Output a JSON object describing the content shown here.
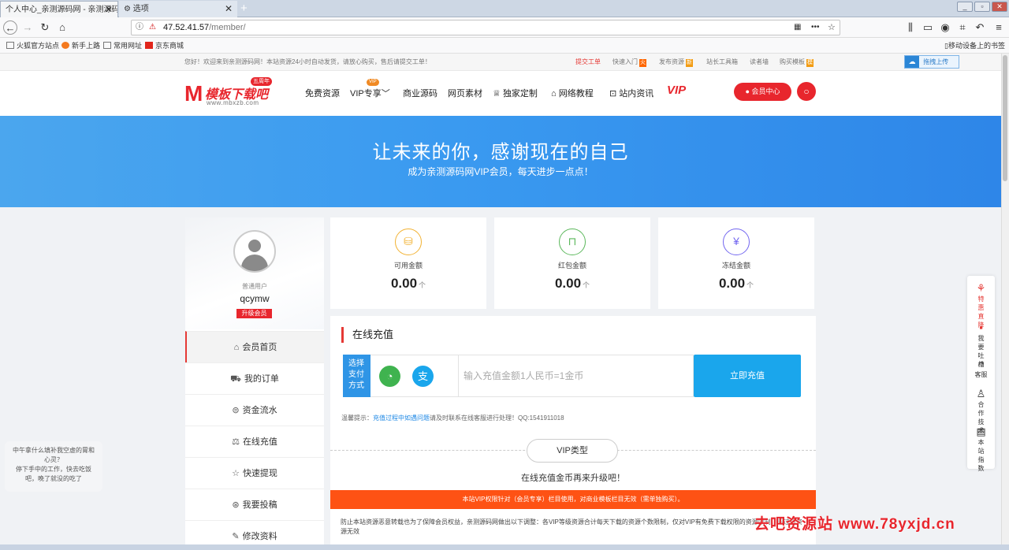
{
  "browser": {
    "tabs": [
      {
        "title": "个人中心_亲测源码网 - 亲测源码网"
      },
      {
        "title": "选项"
      }
    ],
    "new_tab": "+",
    "url": "47.52.41.57/member/",
    "url_host": "47.52.41.57",
    "url_path": "/member/",
    "bookmarks": [
      "火狐官方站点",
      "新手上路",
      "常用网址",
      "京东商城"
    ],
    "mobile_bookmarks": "移动设备上的书签"
  },
  "notice": {
    "text": "您好！欢迎来到亲测源码网！本站资源24小时自动发货，请放心购买，售后请提交工单！",
    "links": [
      "提交工单",
      "快速入门",
      "发布资源",
      "站长工具箱",
      "读者墙",
      "购买模板"
    ],
    "upload": "拖拽上传"
  },
  "header": {
    "logo_text": "模板下载吧",
    "logo_domain": "www.mbxzb.com",
    "logo_badge": "五周年",
    "menu": [
      "免费资源",
      "VIP专享",
      "商业源码",
      "网页素材",
      "独家定制",
      "网络教程",
      "站内资讯"
    ],
    "vip_badge": "VIP",
    "vip_logo": "VIP",
    "member_btn": "会员中心"
  },
  "banner": {
    "title": "让未来的你，感谢现在的自己",
    "subtitle": "成为亲测源码网VIP会员，每天进步一点点！"
  },
  "profile": {
    "role": "普通用户",
    "username": "qcymw",
    "upgrade": "升级会员"
  },
  "sidebar": {
    "items": [
      {
        "label": "会员首页",
        "icon": "home-icon"
      },
      {
        "label": "我的订单",
        "icon": "cart-icon"
      },
      {
        "label": "资金流水",
        "icon": "money-icon"
      },
      {
        "label": "在线充值",
        "icon": "recharge-icon"
      },
      {
        "label": "快速提现",
        "icon": "star-icon"
      },
      {
        "label": "我要投稿",
        "icon": "submit-icon"
      },
      {
        "label": "修改资料",
        "icon": "edit-icon"
      }
    ]
  },
  "stats": [
    {
      "label": "可用金额",
      "value": "0.00",
      "unit": "个",
      "color": "#f2b233"
    },
    {
      "label": "红包金额",
      "value": "0.00",
      "unit": "个",
      "color": "#5cb85c"
    },
    {
      "label": "冻结金额",
      "value": "0.00",
      "unit": "个",
      "color": "#7367f0"
    }
  ],
  "recharge": {
    "title": "在线充值",
    "pay_label": "选择支付方式",
    "amount_placeholder": "输入充值金额1人民币=1金币",
    "button": "立即充值",
    "tip_prefix": "温馨提示：",
    "tip_link": "充值过程中如遇问题",
    "tip_suffix": "请及时联系在线客服进行处理！QQ:1541911018",
    "vip_type": "VIP类型",
    "vip_sub": "在线充值金币再来升级吧！",
    "orange_note": "本站VIP权限针对（会员专享）栏目使用，对商业模板栏目无效（需单独购买）。",
    "terms": "防止本站资源恶意转载也为了保障会员权益，亲测源码网做出以下调整：各VIP等级资源合计每天下载的资源个数限制，仅对VIP有免费下载权限的资源限制，超过的资源无效"
  },
  "float_bar": [
    {
      "label": "特惠直降",
      "icon": "gift-icon",
      "color": "#e53935"
    },
    {
      "label": "我要吐槽",
      "icon": "comment-icon",
      "color": "#333"
    },
    {
      "label": "客服",
      "icon": "headset-icon",
      "color": "#333"
    },
    {
      "label": "合作技术",
      "icon": "user-icon",
      "color": "#333"
    },
    {
      "label": "本站指数",
      "icon": "clipboard-icon",
      "color": "#333"
    }
  ],
  "chat": {
    "line1": "中午拿什么填补我空虚的胃和心灵？",
    "line2": "停下手中的工作，快去吃饭吧，晚了就没的吃了"
  },
  "watermark": "去吧资源站 www.78yxjd.cn",
  "colors": {
    "accent": "#e53935",
    "blue": "#1aa6ec",
    "orange": "#fe5214"
  }
}
